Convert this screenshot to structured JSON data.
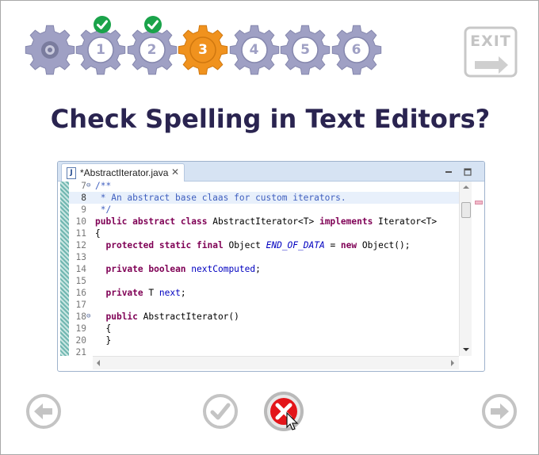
{
  "progress": {
    "current_step": 3,
    "home_icon": "settings-gear-icon",
    "steps": [
      {
        "label": "1",
        "state": "completed"
      },
      {
        "label": "2",
        "state": "completed"
      },
      {
        "label": "3",
        "state": "current"
      },
      {
        "label": "4",
        "state": "pending"
      },
      {
        "label": "5",
        "state": "pending"
      },
      {
        "label": "6",
        "state": "pending"
      }
    ],
    "colors": {
      "pending": "#9fa0c4",
      "current": "#f0921e",
      "check": "#1aa34a"
    }
  },
  "exit": {
    "label": "EXIT",
    "icon": "arrow-right-icon"
  },
  "question": {
    "title": "Check Spelling in Text Editors?"
  },
  "editor": {
    "tab_title": "*AbstractIterator.java",
    "lines": [
      {
        "n": "7",
        "fold": "⊖",
        "segs": [
          {
            "t": "/**",
            "c": "cm"
          }
        ]
      },
      {
        "n": "8",
        "fold": "",
        "segs": [
          {
            "t": " * An abstract base claas for custom iterators.",
            "c": "cm"
          }
        ]
      },
      {
        "n": "9",
        "fold": "",
        "segs": [
          {
            "t": " */",
            "c": "cm"
          }
        ]
      },
      {
        "n": "10",
        "fold": "",
        "segs": [
          {
            "t": "public",
            "c": "kw"
          },
          {
            "t": " "
          },
          {
            "t": "abstract",
            "c": "kw"
          },
          {
            "t": " "
          },
          {
            "t": "class",
            "c": "kw"
          },
          {
            "t": " AbstractIterator<T> "
          },
          {
            "t": "implements",
            "c": "kw"
          },
          {
            "t": " Iterator<T>"
          }
        ]
      },
      {
        "n": "11",
        "fold": "",
        "segs": [
          {
            "t": "{"
          }
        ]
      },
      {
        "n": "12",
        "fold": "",
        "segs": [
          {
            "t": "  "
          },
          {
            "t": "protected",
            "c": "kw"
          },
          {
            "t": " "
          },
          {
            "t": "static",
            "c": "kw"
          },
          {
            "t": " "
          },
          {
            "t": "final",
            "c": "kw"
          },
          {
            "t": " Object "
          },
          {
            "t": "END_OF_DATA",
            "c": "sfld"
          },
          {
            "t": " = "
          },
          {
            "t": "new",
            "c": "kw"
          },
          {
            "t": " Object();"
          }
        ]
      },
      {
        "n": "13",
        "fold": "",
        "segs": []
      },
      {
        "n": "14",
        "fold": "",
        "segs": [
          {
            "t": "  "
          },
          {
            "t": "private",
            "c": "kw"
          },
          {
            "t": " "
          },
          {
            "t": "boolean",
            "c": "kw"
          },
          {
            "t": " "
          },
          {
            "t": "nextComputed",
            "c": "fld"
          },
          {
            "t": ";"
          }
        ]
      },
      {
        "n": "15",
        "fold": "",
        "segs": []
      },
      {
        "n": "16",
        "fold": "",
        "segs": [
          {
            "t": "  "
          },
          {
            "t": "private",
            "c": "kw"
          },
          {
            "t": " T "
          },
          {
            "t": "next",
            "c": "fld"
          },
          {
            "t": ";"
          }
        ]
      },
      {
        "n": "17",
        "fold": "",
        "segs": []
      },
      {
        "n": "18",
        "fold": "⊖",
        "segs": [
          {
            "t": "  "
          },
          {
            "t": "public",
            "c": "kw"
          },
          {
            "t": " AbstractIterator()"
          }
        ]
      },
      {
        "n": "19",
        "fold": "",
        "segs": [
          {
            "t": "  {"
          }
        ]
      },
      {
        "n": "20",
        "fold": "",
        "segs": [
          {
            "t": "  }"
          }
        ]
      },
      {
        "n": "21",
        "fold": "",
        "segs": []
      }
    ],
    "highlight_line": "8"
  },
  "nav": {
    "back_icon": "arrow-left-circle-icon",
    "accept_icon": "checkmark-circle-icon",
    "reject_icon": "x-circle-icon",
    "next_icon": "arrow-right-circle-icon"
  }
}
